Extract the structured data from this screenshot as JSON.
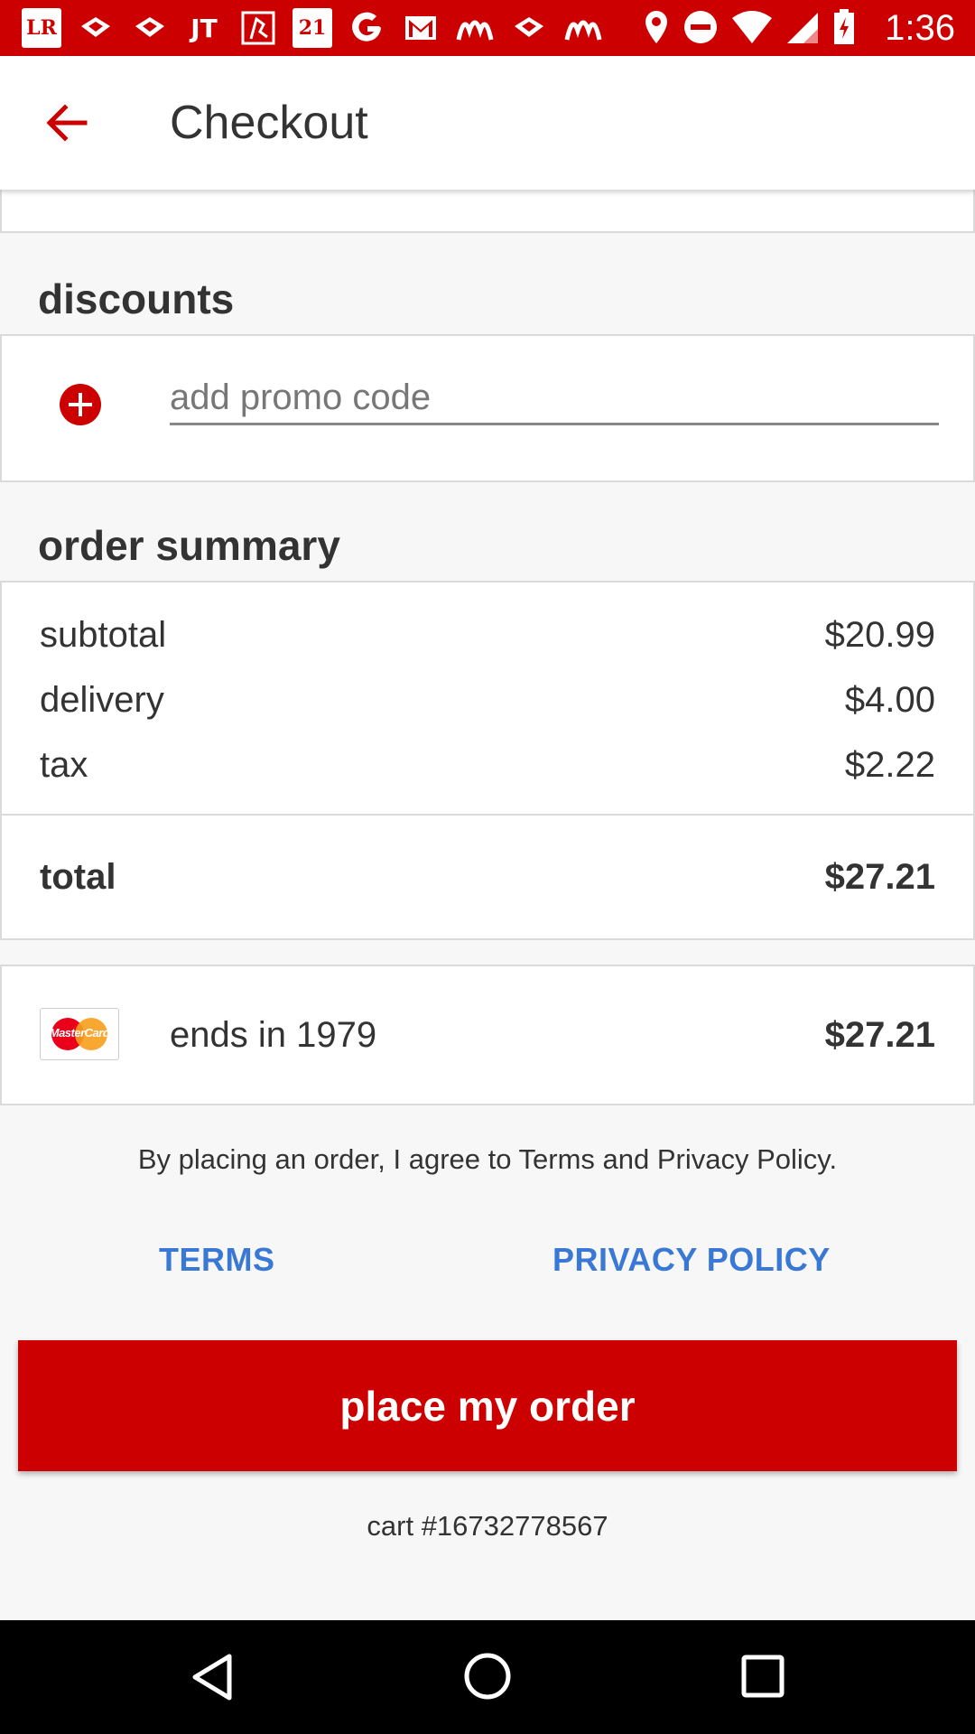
{
  "status_bar": {
    "time": "1:36",
    "app_icons": [
      "lr-icon",
      "dropbox-icon",
      "dropbox-icon",
      "jt-icon",
      "foreverjoy-icon",
      "forever21-icon",
      "google-icon",
      "gmail-icon",
      "moto-icon",
      "dropbox-icon",
      "moto-icon"
    ],
    "lr_label": "LR",
    "jt_label": "JT",
    "f21_label": "21"
  },
  "app_bar": {
    "title": "Checkout"
  },
  "discounts": {
    "title": "discounts",
    "promo_placeholder": "add promo code"
  },
  "order_summary": {
    "title": "order summary",
    "rows": [
      {
        "label": "subtotal",
        "value": "$20.99"
      },
      {
        "label": "delivery",
        "value": "$4.00"
      },
      {
        "label": "tax",
        "value": "$2.22"
      }
    ],
    "total_label": "total",
    "total_value": "$27.21"
  },
  "payment": {
    "card_brand": "MasterCard",
    "card_text": "ends in 1979",
    "amount": "$27.21"
  },
  "legal": {
    "agree_text": "By placing an order, I agree to Terms and Privacy Policy.",
    "terms_label": "TERMS",
    "privacy_label": "PRIVACY POLICY"
  },
  "place_order_label": "place my order",
  "cart_number": "cart #16732778567",
  "colors": {
    "brand_red": "#cc0000",
    "link_blue": "#3a78d6"
  }
}
